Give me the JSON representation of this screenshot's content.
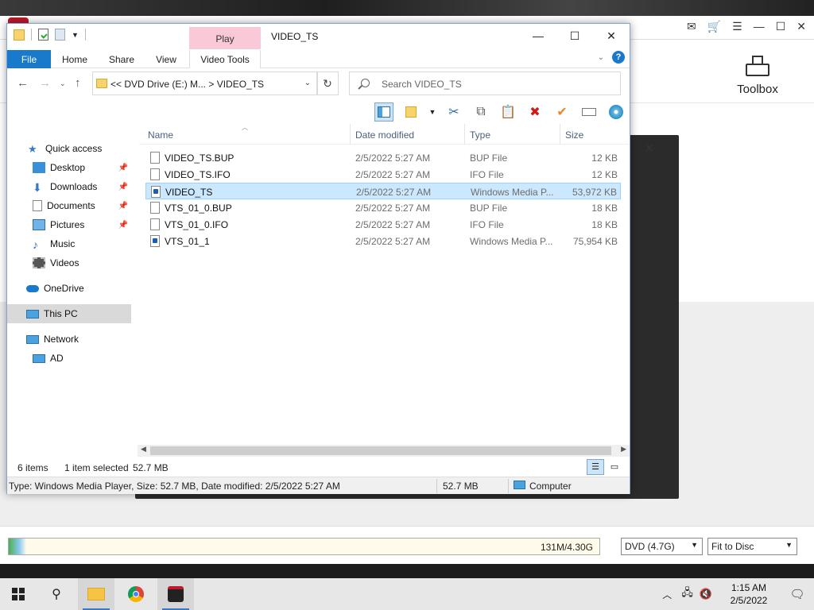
{
  "burner": {
    "toolbox_label": "Toolbox",
    "capacity_text": "131M/4.30G",
    "capacity_fraction": 0.03,
    "disc_type": "DVD (4.7G)",
    "fit_option": "Fit to Disc"
  },
  "explorer": {
    "title": "VIDEO_TS",
    "context_tab": "Play",
    "ribbon_tabs": {
      "file": "File",
      "home": "Home",
      "share": "Share",
      "view": "View",
      "video_tools": "Video Tools"
    },
    "address_path": "<< DVD Drive (E:) M...  >  VIDEO_TS",
    "search_placeholder": "Search VIDEO_TS",
    "nav_items": {
      "quick_access": "Quick access",
      "desktop": "Desktop",
      "downloads": "Downloads",
      "documents": "Documents",
      "pictures": "Pictures",
      "music": "Music",
      "videos": "Videos",
      "onedrive": "OneDrive",
      "this_pc": "This PC",
      "network": "Network",
      "ad": "AD"
    },
    "columns": {
      "name": "Name",
      "date": "Date modified",
      "type": "Type",
      "size": "Size"
    },
    "files": [
      {
        "name": "VIDEO_TS.BUP",
        "date": "2/5/2022 5:27 AM",
        "type": "BUP File",
        "size": "12 KB"
      },
      {
        "name": "VIDEO_TS.IFO",
        "date": "2/5/2022 5:27 AM",
        "type": "IFO File",
        "size": "12 KB"
      },
      {
        "name": "VIDEO_TS",
        "date": "2/5/2022 5:27 AM",
        "type": "Windows Media P...",
        "size": "53,972 KB"
      },
      {
        "name": "VTS_01_0.BUP",
        "date": "2/5/2022 5:27 AM",
        "type": "BUP File",
        "size": "18 KB"
      },
      {
        "name": "VTS_01_0.IFO",
        "date": "2/5/2022 5:27 AM",
        "type": "IFO File",
        "size": "18 KB"
      },
      {
        "name": "VTS_01_1",
        "date": "2/5/2022 5:27 AM",
        "type": "Windows Media P...",
        "size": "75,954 KB"
      }
    ],
    "status": {
      "item_count": "6 items",
      "selected": "1 item selected",
      "selected_size": "52.7 MB"
    },
    "details": {
      "info": "Type: Windows Media Player, Size: 52.7 MB, Date modified: 2/5/2022 5:27 AM",
      "size": "52.7 MB",
      "location": "Computer"
    }
  },
  "taskbar": {
    "time": "1:15 AM",
    "date": "2/5/2022"
  },
  "colors": {
    "accent": "#1979ca",
    "selection": "#cce8ff",
    "context_tab": "#f9c9d8"
  }
}
